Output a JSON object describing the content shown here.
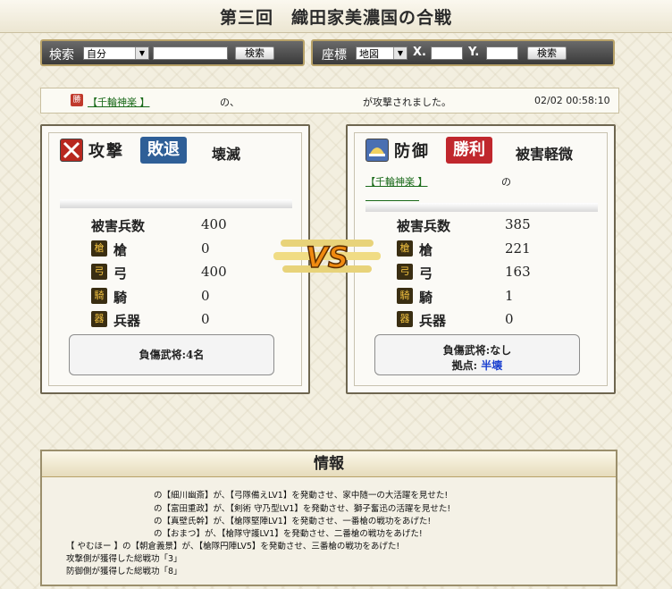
{
  "title": "第三回　織田家美濃国の合戦",
  "search_bar": {
    "label": "検索",
    "select_value": "自分",
    "button": "検索"
  },
  "coord_bar": {
    "label": "座標",
    "select_value": "地図",
    "x_label": "X.",
    "y_label": "Y.",
    "button": "検索"
  },
  "log": {
    "badge": "勝",
    "player": "【千輪神楽 】",
    "no": "の、",
    "message": "が攻撃されました。",
    "timestamp": "02/02 00:58:10"
  },
  "attack": {
    "role": "攻撃",
    "result": "敗退",
    "damage": "壊滅",
    "casualties_label": "被害兵数",
    "casualties": "400",
    "units": [
      {
        "label": "槍",
        "value": "0",
        "icon": "spear-icon"
      },
      {
        "label": "弓",
        "value": "400",
        "icon": "bow-icon"
      },
      {
        "label": "騎",
        "value": "0",
        "icon": "horse-icon"
      },
      {
        "label": "兵器",
        "value": "0",
        "icon": "siege-icon"
      }
    ],
    "injured": "負傷武将:4名"
  },
  "defense": {
    "role": "防御",
    "result": "勝利",
    "damage": "被害軽微",
    "player": "【千輪神楽 】",
    "no": "の",
    "casualties_label": "被害兵数",
    "casualties": "385",
    "units": [
      {
        "label": "槍",
        "value": "221",
        "icon": "spear-icon"
      },
      {
        "label": "弓",
        "value": "163",
        "icon": "bow-icon"
      },
      {
        "label": "騎",
        "value": "1",
        "icon": "horse-icon"
      },
      {
        "label": "兵器",
        "value": "0",
        "icon": "siege-icon"
      }
    ],
    "injured": "負傷武将:なし",
    "base_label": "拠点:",
    "base_value": "半壊"
  },
  "vs": "VS",
  "info": {
    "heading": "情報",
    "lines": [
      "の【細川幽斎】が、【弓隊備えLV1】を発動させ、家中随一の大活躍を見せた!",
      "の【富田重政】が、【剣術 守乃型LV1】を発動させ、獅子奮迅の活躍を見せた!",
      "の【真壁氏幹】が、【槍隊堅陣LV1】を発動させ、一番槍の戦功をあげた!",
      "の【おまつ】が、【槍隊守護LV1】を発動させ、二番槍の戦功をあげた!",
      "【 やむほー 】の【朝倉義景】が、【槍隊円陣LV5】を発動させ、三番槍の戦功をあげた!",
      "攻撃側が獲得した総戦功「3」",
      "防御側が獲得した総戦功「8」"
    ]
  },
  "colors": {
    "defeat_badge": "#2f5f97",
    "victory_badge": "#c0272d",
    "base_value": "#1a3fcf",
    "link": "#1a6a1a"
  }
}
